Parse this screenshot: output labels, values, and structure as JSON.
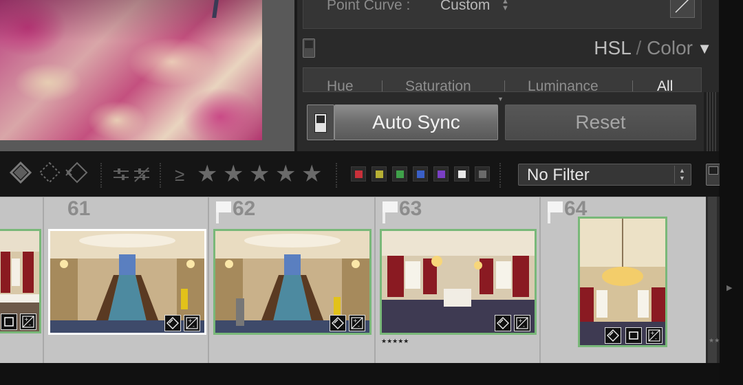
{
  "tone_curve": {
    "point_curve_label": "Point Curve :",
    "point_curve_value": "Custom"
  },
  "hsl_panel": {
    "title_hsl": "HSL",
    "title_sep": "/",
    "title_color": "Color",
    "tabs": [
      "Hue",
      "Saturation",
      "Luminance",
      "All"
    ],
    "active_tab": "All"
  },
  "sync": {
    "auto_sync_label": "Auto Sync",
    "reset_label": "Reset"
  },
  "filter_bar": {
    "rating_operator": "≥",
    "stars": [
      "★",
      "★",
      "★",
      "★",
      "★"
    ],
    "color_labels": [
      {
        "name": "red",
        "color": "#c8303a"
      },
      {
        "name": "yellow",
        "color": "#b7b034"
      },
      {
        "name": "green",
        "color": "#3fa14a"
      },
      {
        "name": "blue",
        "color": "#3a5fc7"
      },
      {
        "name": "purple",
        "color": "#7a3fc4"
      },
      {
        "name": "white",
        "color": "#e8e8e8"
      },
      {
        "name": "none",
        "color": "#6a6a6a"
      }
    ],
    "filter_value": "No Filter"
  },
  "filmstrip": {
    "cells": [
      {
        "number": "61",
        "flagged": false,
        "rating_text": ""
      },
      {
        "number": "62",
        "flagged": true,
        "rating_text": ""
      },
      {
        "number": "63",
        "flagged": true,
        "rating_text": "★★★★★"
      },
      {
        "number": "64",
        "flagged": true,
        "rating_text": ""
      }
    ],
    "partial_right_rating": "★★"
  },
  "colors": {
    "accent_selected_border": "#79b879",
    "panel_bg": "#2a2a2a",
    "filmstrip_bg": "#c4c4c4"
  }
}
